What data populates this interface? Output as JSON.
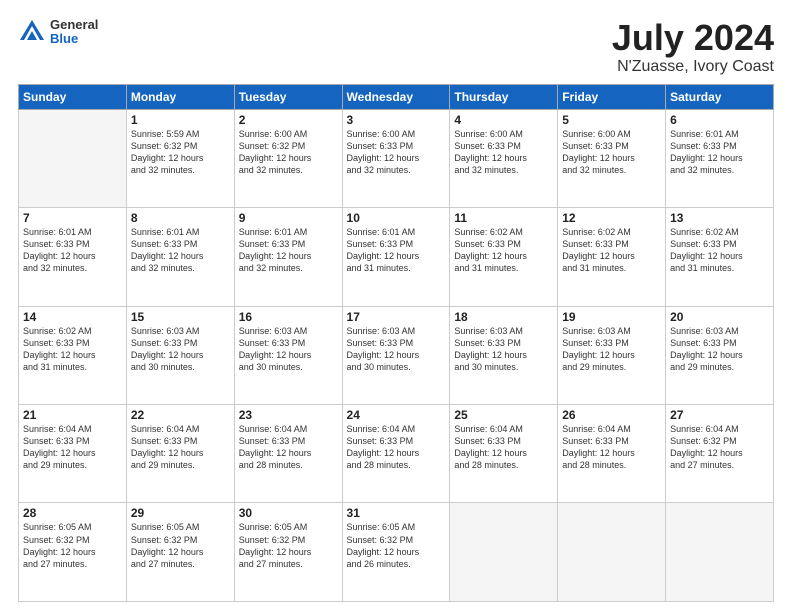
{
  "header": {
    "logo_general": "General",
    "logo_blue": "Blue",
    "title": "July 2024",
    "subtitle": "N'Zuasse, Ivory Coast"
  },
  "weekdays": [
    "Sunday",
    "Monday",
    "Tuesday",
    "Wednesday",
    "Thursday",
    "Friday",
    "Saturday"
  ],
  "weeks": [
    [
      {
        "day": "",
        "info": ""
      },
      {
        "day": "1",
        "info": "Sunrise: 5:59 AM\nSunset: 6:32 PM\nDaylight: 12 hours\nand 32 minutes."
      },
      {
        "day": "2",
        "info": "Sunrise: 6:00 AM\nSunset: 6:32 PM\nDaylight: 12 hours\nand 32 minutes."
      },
      {
        "day": "3",
        "info": "Sunrise: 6:00 AM\nSunset: 6:33 PM\nDaylight: 12 hours\nand 32 minutes."
      },
      {
        "day": "4",
        "info": "Sunrise: 6:00 AM\nSunset: 6:33 PM\nDaylight: 12 hours\nand 32 minutes."
      },
      {
        "day": "5",
        "info": "Sunrise: 6:00 AM\nSunset: 6:33 PM\nDaylight: 12 hours\nand 32 minutes."
      },
      {
        "day": "6",
        "info": "Sunrise: 6:01 AM\nSunset: 6:33 PM\nDaylight: 12 hours\nand 32 minutes."
      }
    ],
    [
      {
        "day": "7",
        "info": "Sunrise: 6:01 AM\nSunset: 6:33 PM\nDaylight: 12 hours\nand 32 minutes."
      },
      {
        "day": "8",
        "info": "Sunrise: 6:01 AM\nSunset: 6:33 PM\nDaylight: 12 hours\nand 32 minutes."
      },
      {
        "day": "9",
        "info": "Sunrise: 6:01 AM\nSunset: 6:33 PM\nDaylight: 12 hours\nand 32 minutes."
      },
      {
        "day": "10",
        "info": "Sunrise: 6:01 AM\nSunset: 6:33 PM\nDaylight: 12 hours\nand 31 minutes."
      },
      {
        "day": "11",
        "info": "Sunrise: 6:02 AM\nSunset: 6:33 PM\nDaylight: 12 hours\nand 31 minutes."
      },
      {
        "day": "12",
        "info": "Sunrise: 6:02 AM\nSunset: 6:33 PM\nDaylight: 12 hours\nand 31 minutes."
      },
      {
        "day": "13",
        "info": "Sunrise: 6:02 AM\nSunset: 6:33 PM\nDaylight: 12 hours\nand 31 minutes."
      }
    ],
    [
      {
        "day": "14",
        "info": "Sunrise: 6:02 AM\nSunset: 6:33 PM\nDaylight: 12 hours\nand 31 minutes."
      },
      {
        "day": "15",
        "info": "Sunrise: 6:03 AM\nSunset: 6:33 PM\nDaylight: 12 hours\nand 30 minutes."
      },
      {
        "day": "16",
        "info": "Sunrise: 6:03 AM\nSunset: 6:33 PM\nDaylight: 12 hours\nand 30 minutes."
      },
      {
        "day": "17",
        "info": "Sunrise: 6:03 AM\nSunset: 6:33 PM\nDaylight: 12 hours\nand 30 minutes."
      },
      {
        "day": "18",
        "info": "Sunrise: 6:03 AM\nSunset: 6:33 PM\nDaylight: 12 hours\nand 30 minutes."
      },
      {
        "day": "19",
        "info": "Sunrise: 6:03 AM\nSunset: 6:33 PM\nDaylight: 12 hours\nand 29 minutes."
      },
      {
        "day": "20",
        "info": "Sunrise: 6:03 AM\nSunset: 6:33 PM\nDaylight: 12 hours\nand 29 minutes."
      }
    ],
    [
      {
        "day": "21",
        "info": "Sunrise: 6:04 AM\nSunset: 6:33 PM\nDaylight: 12 hours\nand 29 minutes."
      },
      {
        "day": "22",
        "info": "Sunrise: 6:04 AM\nSunset: 6:33 PM\nDaylight: 12 hours\nand 29 minutes."
      },
      {
        "day": "23",
        "info": "Sunrise: 6:04 AM\nSunset: 6:33 PM\nDaylight: 12 hours\nand 28 minutes."
      },
      {
        "day": "24",
        "info": "Sunrise: 6:04 AM\nSunset: 6:33 PM\nDaylight: 12 hours\nand 28 minutes."
      },
      {
        "day": "25",
        "info": "Sunrise: 6:04 AM\nSunset: 6:33 PM\nDaylight: 12 hours\nand 28 minutes."
      },
      {
        "day": "26",
        "info": "Sunrise: 6:04 AM\nSunset: 6:33 PM\nDaylight: 12 hours\nand 28 minutes."
      },
      {
        "day": "27",
        "info": "Sunrise: 6:04 AM\nSunset: 6:32 PM\nDaylight: 12 hours\nand 27 minutes."
      }
    ],
    [
      {
        "day": "28",
        "info": "Sunrise: 6:05 AM\nSunset: 6:32 PM\nDaylight: 12 hours\nand 27 minutes."
      },
      {
        "day": "29",
        "info": "Sunrise: 6:05 AM\nSunset: 6:32 PM\nDaylight: 12 hours\nand 27 minutes."
      },
      {
        "day": "30",
        "info": "Sunrise: 6:05 AM\nSunset: 6:32 PM\nDaylight: 12 hours\nand 27 minutes."
      },
      {
        "day": "31",
        "info": "Sunrise: 6:05 AM\nSunset: 6:32 PM\nDaylight: 12 hours\nand 26 minutes."
      },
      {
        "day": "",
        "info": ""
      },
      {
        "day": "",
        "info": ""
      },
      {
        "day": "",
        "info": ""
      }
    ]
  ]
}
